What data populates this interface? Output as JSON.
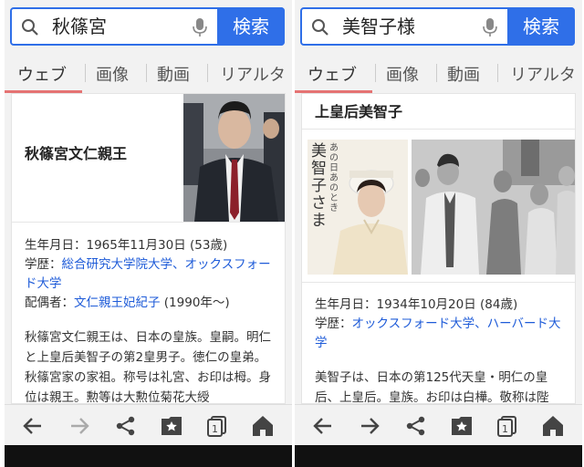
{
  "left": {
    "search": {
      "query": "秋篠宮",
      "button": "検索"
    },
    "tabs": [
      {
        "label": "ウェブ"
      },
      {
        "label": "画像"
      },
      {
        "label": "動画"
      },
      {
        "label": "リアルタ"
      }
    ],
    "card": {
      "title": "秋篠宮文仁親王",
      "birth": "生年月日：1965年11月30日 (53歳)",
      "education_label": "学歴：",
      "education_links": "総合研究大学院大学、オックスフォード大学",
      "spouse_label": "配偶者：",
      "spouse_link": "文仁親王妃紀子",
      "spouse_suffix": " (1990年〜)",
      "description": "秋篠宮文仁親王は、日本の皇族。皇嗣。明仁と上皇后美智子の第2皇男子。徳仁の皇弟。秋篠宮家の家祖。称号は礼宮、お印は栂。身位は親王。勲等は大勲位菊花大綬"
    }
  },
  "right": {
    "search": {
      "query": "美智子様",
      "button": "検索"
    },
    "tabs": [
      {
        "label": "ウェブ"
      },
      {
        "label": "画像"
      },
      {
        "label": "動画"
      },
      {
        "label": "リアルタ"
      }
    ],
    "card": {
      "title": "上皇后美智子",
      "book_text_1": "美智子さま",
      "book_text_2": "あの日 あのとき",
      "birth": "生年月日：1934年10月20日 (84歳)",
      "education_label": "学歴：",
      "education_links": "オックスフォード大学、ハーバード大学",
      "description": "美智子は、日本の第125代天皇・明仁の皇后、上皇后。皇族。お印は白樺。敬称は陛"
    }
  },
  "colors": {
    "accent": "#2f6fe8",
    "tab_underline": "#e57373",
    "link": "#1e5bd8"
  },
  "icons": [
    "search-icon",
    "mic-icon",
    "back-icon",
    "forward-icon",
    "share-icon",
    "bookmark-icon",
    "tabs-icon",
    "home-icon"
  ]
}
